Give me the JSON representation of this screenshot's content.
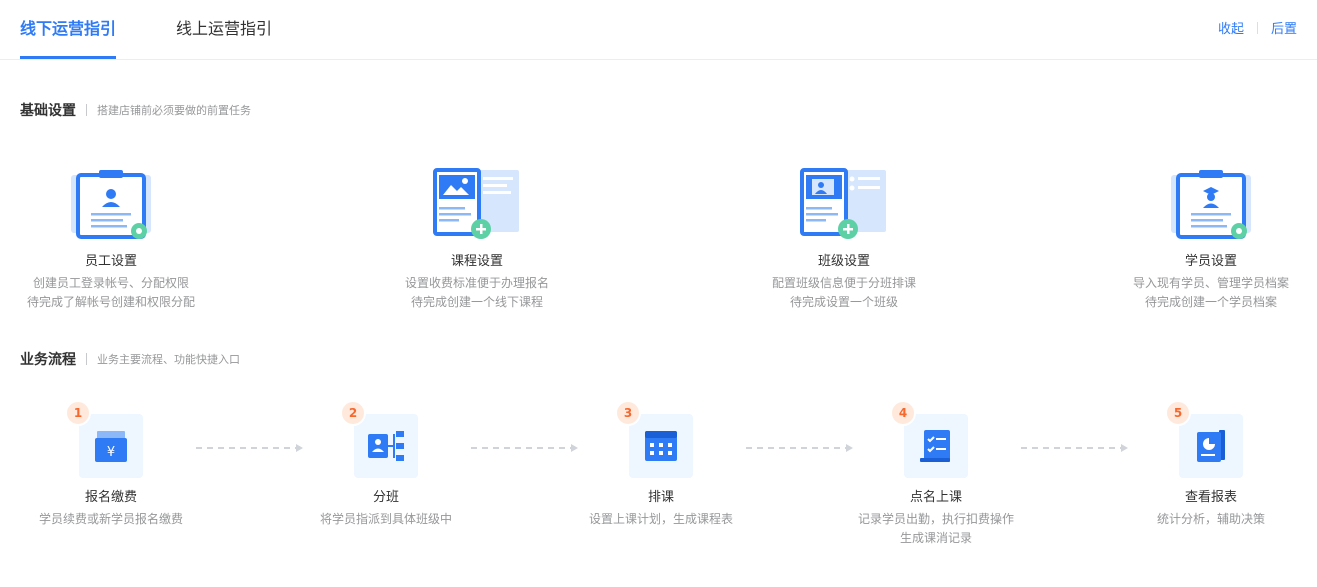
{
  "tabs": [
    {
      "label": "线下运营指引",
      "active": true
    },
    {
      "label": "线上运营指引",
      "active": false
    }
  ],
  "actions": {
    "collapse": "收起",
    "pin_bottom": "后置"
  },
  "basic": {
    "title": "基础设置",
    "desc": "搭建店铺前必须要做的前置任务",
    "cards": [
      {
        "title": "员工设置",
        "desc1": "创建员工登录帐号、分配权限",
        "desc2": "待完成了解帐号创建和权限分配",
        "icon": "staff-clipboard-icon"
      },
      {
        "title": "课程设置",
        "desc1": "设置收费标准便于办理报名",
        "desc2": "待完成创建一个线下课程",
        "icon": "course-image-icon"
      },
      {
        "title": "班级设置",
        "desc1": "配置班级信息便于分班排课",
        "desc2": "待完成设置一个班级",
        "icon": "class-board-icon"
      },
      {
        "title": "学员设置",
        "desc1": "导入现有学员、管理学员档案",
        "desc2": "待完成创建一个学员档案",
        "icon": "student-clipboard-icon"
      }
    ]
  },
  "flow": {
    "title": "业务流程",
    "desc": "业务主要流程、功能快捷入口",
    "steps": [
      {
        "num": "1",
        "title": "报名缴费",
        "desc1": "学员续费或新学员报名缴费",
        "desc2": "",
        "icon": "payment-box-icon"
      },
      {
        "num": "2",
        "title": "分班",
        "desc1": "将学员指派到具体班级中",
        "desc2": "",
        "icon": "assign-class-icon"
      },
      {
        "num": "3",
        "title": "排课",
        "desc1": "设置上课计划，生成课程表",
        "desc2": "",
        "icon": "calendar-icon"
      },
      {
        "num": "4",
        "title": "点名上课",
        "desc1": "记录学员出勤，执行扣费操作",
        "desc2": "生成课消记录",
        "icon": "roll-call-icon"
      },
      {
        "num": "5",
        "title": "查看报表",
        "desc1": "统计分析，辅助决策",
        "desc2": "",
        "icon": "report-chart-icon"
      }
    ]
  },
  "colors": {
    "accent": "#2f7bf5",
    "light_blue": "#d6e6fd",
    "green": "#5ed0a6",
    "step_orange": "#f5692f"
  }
}
